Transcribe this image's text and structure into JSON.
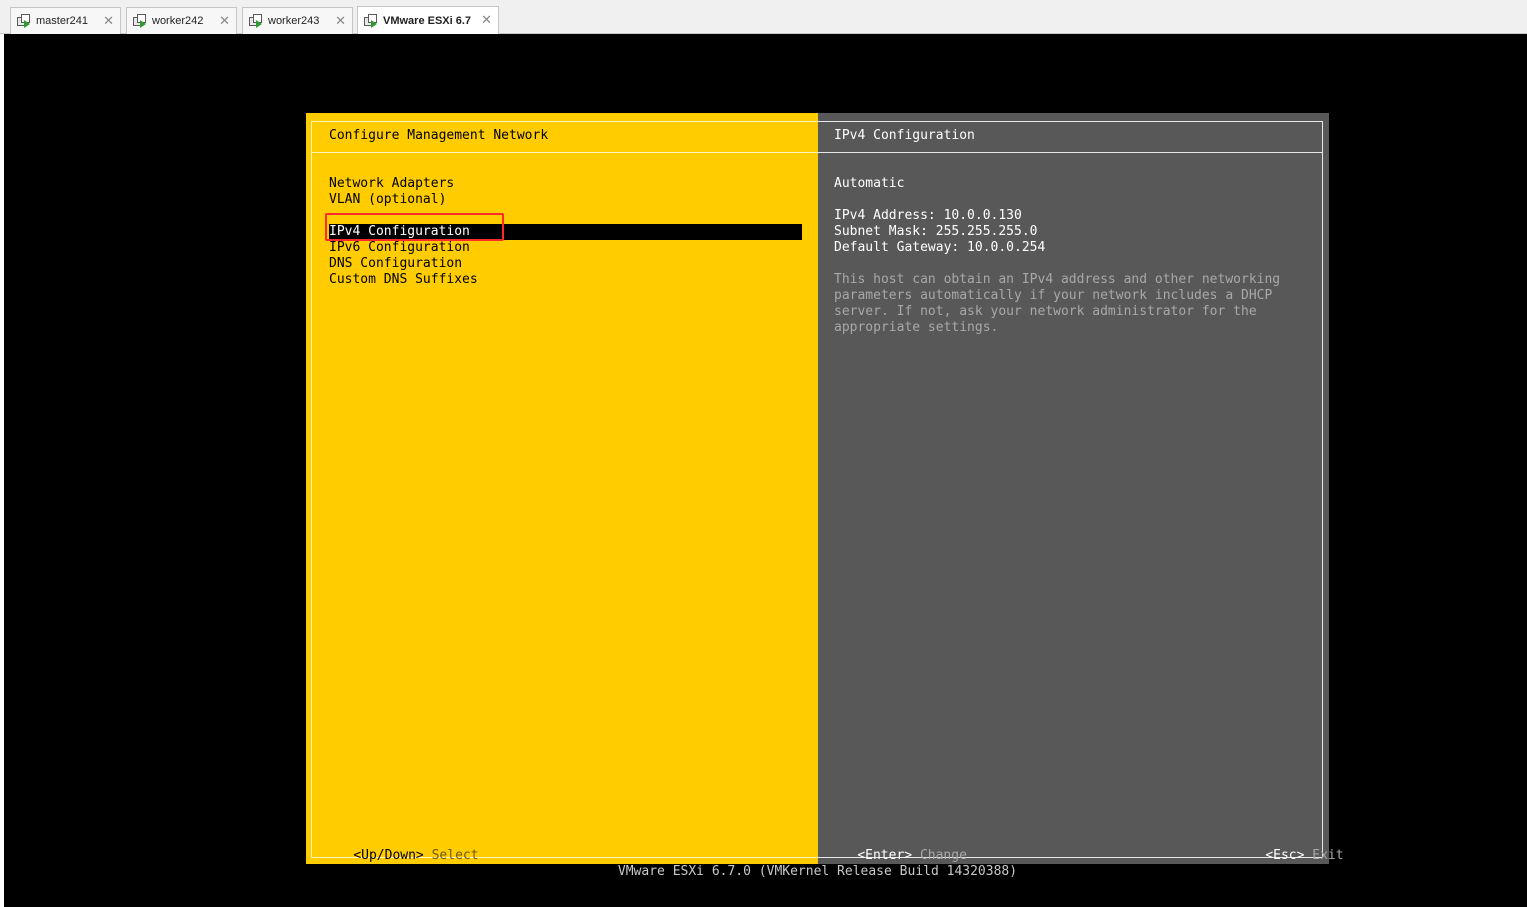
{
  "tabs": [
    {
      "label": "master241",
      "active": false
    },
    {
      "label": "worker242",
      "active": false
    },
    {
      "label": "worker243",
      "active": false
    },
    {
      "label": "VMware ESXi 6.7",
      "active": true
    }
  ],
  "left": {
    "title": "Configure Management Network",
    "menu": [
      "Network Adapters",
      "VLAN (optional)",
      "IPv4 Configuration",
      "IPv6 Configuration",
      "DNS Configuration",
      "Custom DNS Suffixes"
    ],
    "selected_item": "IPv4 Configuration",
    "hint_key": "<Up/Down>",
    "hint_action": "Select"
  },
  "right": {
    "title": "IPv4 Configuration",
    "mode": "Automatic",
    "ipv4_address": "IPv4 Address: 10.0.0.130",
    "subnet_mask": "Subnet Mask: 255.255.255.0",
    "default_gateway": "Default Gateway: 10.0.0.254",
    "description": [
      "This host can obtain an IPv4 address and other networking",
      "parameters automatically if your network includes a DHCP",
      "server. If not, ask your network administrator for the",
      "appropriate settings."
    ],
    "enter_key": "<Enter>",
    "enter_action": "Change",
    "esc_key": "<Esc>",
    "esc_action": "Exit"
  },
  "footer": "VMware ESXi 6.7.0 (VMKernel Release Build 14320388)",
  "colors": {
    "left_panel": "#ffcc00",
    "right_panel": "#585858",
    "highlight_box": "#ff2a2a"
  }
}
